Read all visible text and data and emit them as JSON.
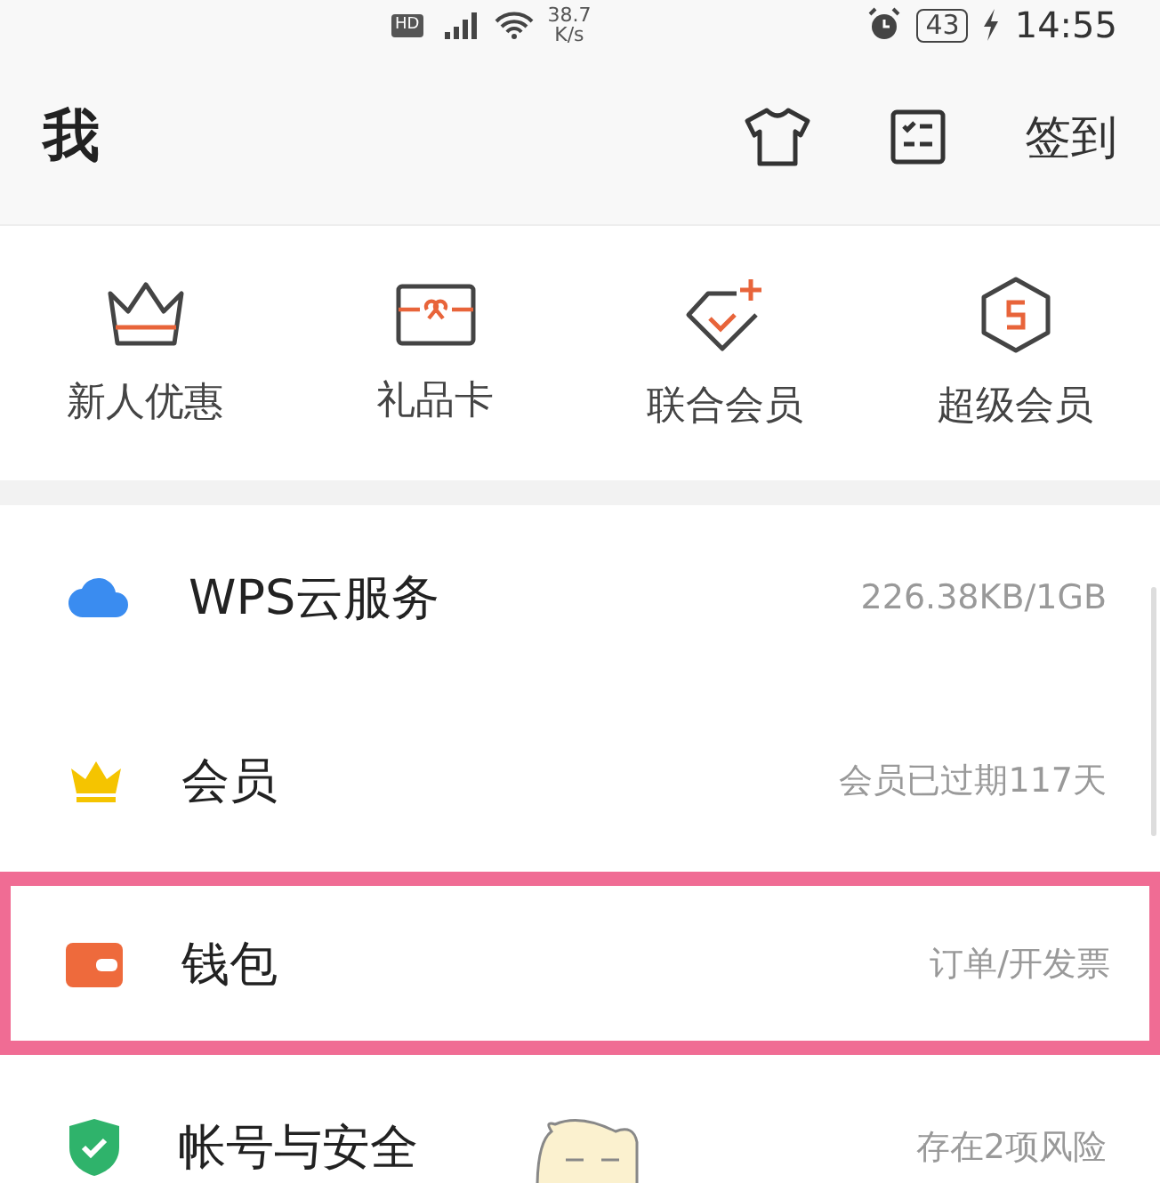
{
  "status_bar": {
    "hd": "HD",
    "speed": "38.7",
    "speed_unit": "K/s",
    "battery": "43",
    "time": "14:55"
  },
  "header": {
    "title": "我",
    "action": "签到"
  },
  "shortcuts": [
    {
      "kind": "crown",
      "label": "新人优惠"
    },
    {
      "kind": "gift",
      "label": "礼品卡"
    },
    {
      "kind": "diamond",
      "label": "联合会员"
    },
    {
      "kind": "hexagon",
      "label": "超级会员"
    }
  ],
  "menu": [
    {
      "kind": "cloud",
      "label": "WPS云服务",
      "detail": "226.38KB/1GB",
      "highlighted": false
    },
    {
      "kind": "vip",
      "label": "会员",
      "detail": "会员已过期117天",
      "highlighted": false
    },
    {
      "kind": "wallet",
      "label": "钱包",
      "detail": "订单/开发票",
      "highlighted": true
    },
    {
      "kind": "shield",
      "label": "帐号与安全",
      "detail": "存在2项风险",
      "highlighted": false
    }
  ]
}
